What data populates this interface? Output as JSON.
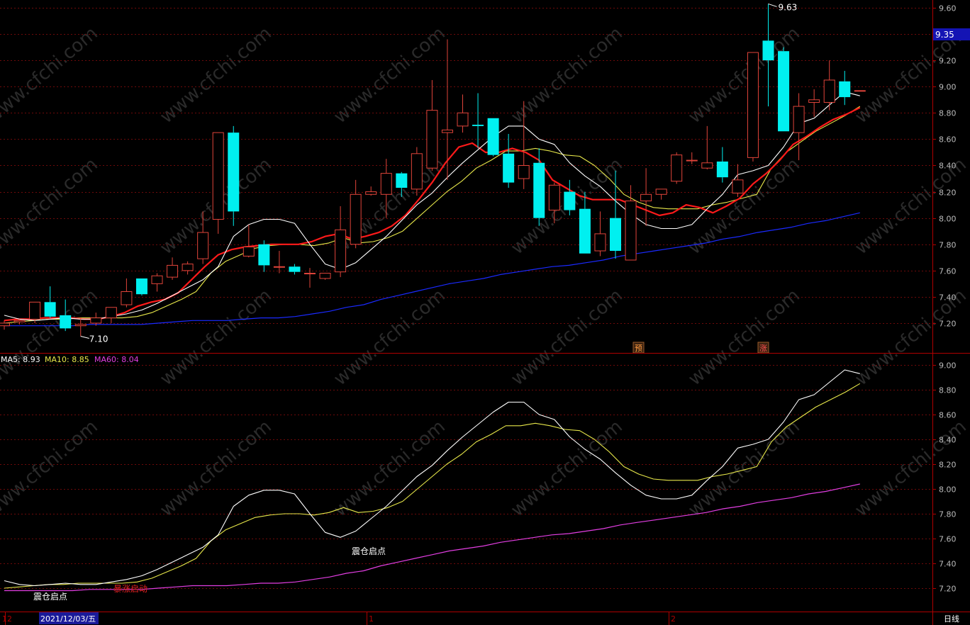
{
  "colors": {
    "background": "#000000",
    "grid": "#6e0a0a",
    "axis": "#b00000",
    "up_candle": "#e0443a",
    "down_candle": "#00f0f0",
    "ma5": "#ffffff",
    "ma10": "#e8e84a",
    "ma20": "#ff1a1a",
    "ma60": "#1a2aff",
    "sub_ma60": "#e23ee2",
    "price_label": "#bbbbbb",
    "current_price_bg": "#1414b4"
  },
  "watermark_text": "www.cfchi.com",
  "main_panel": {
    "y_ticks": [
      "9.60",
      "9.40",
      "9.20",
      "9.00",
      "8.80",
      "8.60",
      "8.40",
      "8.20",
      "8.00",
      "7.80",
      "7.60",
      "7.40",
      "7.20"
    ],
    "current_price_tag": "9.35",
    "high_marker": "9.63",
    "low_marker": "7.10",
    "signal_badges": [
      "预",
      "涨"
    ]
  },
  "sub_panel": {
    "legend": {
      "ma5": "MA5: 8.93",
      "ma10": "MA10: 8.85",
      "ma60": "MA60: 8.04"
    },
    "y_ticks": [
      "9.00",
      "8.80",
      "8.60",
      "8.40",
      "8.20",
      "8.00",
      "7.80",
      "7.60",
      "7.40",
      "7.20"
    ],
    "annotations": [
      "震仓启点",
      "暴涨启动",
      "震仓启点"
    ]
  },
  "bottom_bar": {
    "month_labels": [
      "12",
      "1",
      "2"
    ],
    "date_label": "2021/12/03/五",
    "period_label": "日线"
  },
  "chart_data": {
    "type": "candlestick",
    "ylim": [
      7.0,
      9.68
    ],
    "candles": [
      {
        "o": 7.18,
        "h": 7.22,
        "l": 7.15,
        "c": 7.2
      },
      {
        "o": 7.21,
        "h": 7.23,
        "l": 7.19,
        "c": 7.22
      },
      {
        "o": 7.23,
        "h": 7.36,
        "l": 7.2,
        "c": 7.36
      },
      {
        "o": 7.36,
        "h": 7.48,
        "l": 7.24,
        "c": 7.25
      },
      {
        "o": 7.26,
        "h": 7.38,
        "l": 7.14,
        "c": 7.16
      },
      {
        "o": 7.18,
        "h": 7.24,
        "l": 7.1,
        "c": 7.19
      },
      {
        "o": 7.2,
        "h": 7.28,
        "l": 7.18,
        "c": 7.24
      },
      {
        "o": 7.24,
        "h": 7.32,
        "l": 7.2,
        "c": 7.32
      },
      {
        "o": 7.34,
        "h": 7.54,
        "l": 7.32,
        "c": 7.44
      },
      {
        "o": 7.54,
        "h": 7.54,
        "l": 7.41,
        "c": 7.42
      },
      {
        "o": 7.5,
        "h": 7.58,
        "l": 7.44,
        "c": 7.56
      },
      {
        "o": 7.55,
        "h": 7.7,
        "l": 7.53,
        "c": 7.64
      },
      {
        "o": 7.6,
        "h": 7.67,
        "l": 7.57,
        "c": 7.65
      },
      {
        "o": 7.69,
        "h": 8.05,
        "l": 7.65,
        "c": 7.89
      },
      {
        "o": 7.99,
        "h": 8.16,
        "l": 7.88,
        "c": 8.65
      },
      {
        "o": 8.65,
        "h": 8.7,
        "l": 7.94,
        "c": 8.05
      },
      {
        "o": 7.71,
        "h": 7.95,
        "l": 7.7,
        "c": 7.78
      },
      {
        "o": 7.8,
        "h": 7.83,
        "l": 7.59,
        "c": 7.64
      },
      {
        "o": 7.63,
        "h": 7.75,
        "l": 7.58,
        "c": 7.63
      },
      {
        "o": 7.63,
        "h": 7.65,
        "l": 7.57,
        "c": 7.59
      },
      {
        "o": 7.58,
        "h": 7.62,
        "l": 7.47,
        "c": 7.58
      },
      {
        "o": 7.54,
        "h": 7.58,
        "l": 7.53,
        "c": 7.58
      },
      {
        "o": 7.59,
        "h": 8.09,
        "l": 7.55,
        "c": 7.91
      },
      {
        "o": 7.8,
        "h": 8.29,
        "l": 7.77,
        "c": 8.18
      },
      {
        "o": 8.18,
        "h": 8.24,
        "l": 8.17,
        "c": 8.2
      },
      {
        "o": 8.18,
        "h": 8.45,
        "l": 8.0,
        "c": 8.34
      },
      {
        "o": 8.34,
        "h": 8.35,
        "l": 8.16,
        "c": 8.23
      },
      {
        "o": 8.22,
        "h": 8.54,
        "l": 8.17,
        "c": 8.49
      },
      {
        "o": 8.38,
        "h": 9.05,
        "l": 8.36,
        "c": 8.82
      },
      {
        "o": 8.65,
        "h": 9.36,
        "l": 8.29,
        "c": 8.67
      },
      {
        "o": 8.7,
        "h": 8.94,
        "l": 8.65,
        "c": 8.8
      },
      {
        "o": 8.71,
        "h": 8.95,
        "l": 8.53,
        "c": 8.7
      },
      {
        "o": 8.76,
        "h": 8.76,
        "l": 8.47,
        "c": 8.48
      },
      {
        "o": 8.49,
        "h": 8.64,
        "l": 8.23,
        "c": 8.27
      },
      {
        "o": 8.3,
        "h": 8.89,
        "l": 8.22,
        "c": 8.4
      },
      {
        "o": 8.42,
        "h": 8.53,
        "l": 7.94,
        "c": 8.0
      },
      {
        "o": 8.06,
        "h": 8.27,
        "l": 7.96,
        "c": 8.25
      },
      {
        "o": 8.2,
        "h": 8.29,
        "l": 8.02,
        "c": 8.06
      },
      {
        "o": 8.07,
        "h": 8.2,
        "l": 7.73,
        "c": 7.73
      },
      {
        "o": 7.75,
        "h": 8.05,
        "l": 7.71,
        "c": 7.88
      },
      {
        "o": 8.0,
        "h": 8.36,
        "l": 7.69,
        "c": 7.75
      },
      {
        "o": 7.68,
        "h": 8.25,
        "l": 7.68,
        "c": 8.13
      },
      {
        "o": 8.13,
        "h": 8.38,
        "l": 7.94,
        "c": 8.18
      },
      {
        "o": 8.18,
        "h": 8.22,
        "l": 8.14,
        "c": 8.22
      },
      {
        "o": 8.28,
        "h": 8.5,
        "l": 8.26,
        "c": 8.48
      },
      {
        "o": 8.44,
        "h": 8.5,
        "l": 8.41,
        "c": 8.44
      },
      {
        "o": 8.38,
        "h": 8.7,
        "l": 8.37,
        "c": 8.42
      },
      {
        "o": 8.43,
        "h": 8.54,
        "l": 8.27,
        "c": 8.31
      },
      {
        "o": 8.19,
        "h": 8.41,
        "l": 8.16,
        "c": 8.29
      },
      {
        "o": 8.46,
        "h": 9.26,
        "l": 8.43,
        "c": 9.26
      },
      {
        "o": 9.35,
        "h": 9.63,
        "l": 8.85,
        "c": 9.2
      },
      {
        "o": 9.27,
        "h": 9.3,
        "l": 8.66,
        "c": 8.66
      },
      {
        "o": 8.65,
        "h": 8.95,
        "l": 8.44,
        "c": 8.85
      },
      {
        "o": 8.88,
        "h": 8.98,
        "l": 8.77,
        "c": 8.9
      },
      {
        "o": 8.88,
        "h": 9.2,
        "l": 8.82,
        "c": 9.05
      },
      {
        "o": 9.04,
        "h": 9.12,
        "l": 8.86,
        "c": 8.92
      },
      {
        "o": 8.97,
        "h": 8.97,
        "l": 8.97,
        "c": 8.97
      }
    ],
    "ma5": [
      7.26,
      7.23,
      7.22,
      7.23,
      7.24,
      7.23,
      7.23,
      7.25,
      7.27,
      7.3,
      7.35,
      7.41,
      7.47,
      7.53,
      7.63,
      7.86,
      7.95,
      7.99,
      7.99,
      7.96,
      7.8,
      7.65,
      7.61,
      7.66,
      7.76,
      7.86,
      7.98,
      8.1,
      8.19,
      8.31,
      8.42,
      8.52,
      8.62,
      8.7,
      8.7,
      8.6,
      8.56,
      8.42,
      8.32,
      8.24,
      8.13,
      8.03,
      7.95,
      7.92,
      7.92,
      7.95,
      8.07,
      8.18,
      8.33,
      8.36,
      8.4,
      8.54,
      8.72,
      8.76,
      8.86,
      8.96,
      8.93
    ],
    "ma10": [
      7.2,
      7.21,
      7.22,
      7.23,
      7.23,
      7.24,
      7.24,
      7.24,
      7.24,
      7.25,
      7.28,
      7.33,
      7.38,
      7.44,
      7.58,
      7.67,
      7.72,
      7.77,
      7.79,
      7.8,
      7.8,
      7.79,
      7.81,
      7.85,
      7.81,
      7.82,
      7.85,
      7.9,
      8.0,
      8.1,
      8.2,
      8.28,
      8.38,
      8.44,
      8.51,
      8.51,
      8.53,
      8.51,
      8.48,
      8.47,
      8.4,
      8.3,
      8.18,
      8.12,
      8.08,
      8.07,
      8.07,
      8.07,
      8.1,
      8.12,
      8.15,
      8.18,
      8.38,
      8.5,
      8.58,
      8.66,
      8.72,
      8.78,
      8.85
    ],
    "ma20": [
      7.22,
      7.23,
      7.23,
      7.24,
      7.24,
      7.24,
      7.23,
      7.23,
      7.25,
      7.28,
      7.33,
      7.36,
      7.38,
      7.43,
      7.53,
      7.63,
      7.72,
      7.76,
      7.78,
      7.79,
      7.8,
      7.8,
      7.8,
      7.82,
      7.86,
      7.88,
      7.84,
      7.86,
      7.89,
      7.94,
      8.02,
      8.14,
      8.27,
      8.42,
      8.54,
      8.57,
      8.5,
      8.5,
      8.53,
      8.5,
      8.44,
      8.29,
      8.23,
      8.17,
      8.14,
      8.14,
      8.14,
      8.1,
      8.06,
      8.02,
      8.04,
      8.1,
      8.08,
      8.04,
      8.09,
      8.15,
      8.26,
      8.34,
      8.44,
      8.56,
      8.62,
      8.69,
      8.75,
      8.79,
      8.84
    ],
    "ma60": [
      7.18,
      7.18,
      7.18,
      7.18,
      7.18,
      7.19,
      7.19,
      7.19,
      7.19,
      7.2,
      7.21,
      7.22,
      7.22,
      7.22,
      7.23,
      7.24,
      7.24,
      7.25,
      7.27,
      7.29,
      7.32,
      7.34,
      7.38,
      7.41,
      7.44,
      7.47,
      7.5,
      7.52,
      7.54,
      7.57,
      7.59,
      7.61,
      7.63,
      7.64,
      7.66,
      7.68,
      7.71,
      7.73,
      7.75,
      7.77,
      7.79,
      7.81,
      7.84,
      7.86,
      7.89,
      7.91,
      7.93,
      7.96,
      7.98,
      8.01,
      8.04
    ]
  }
}
